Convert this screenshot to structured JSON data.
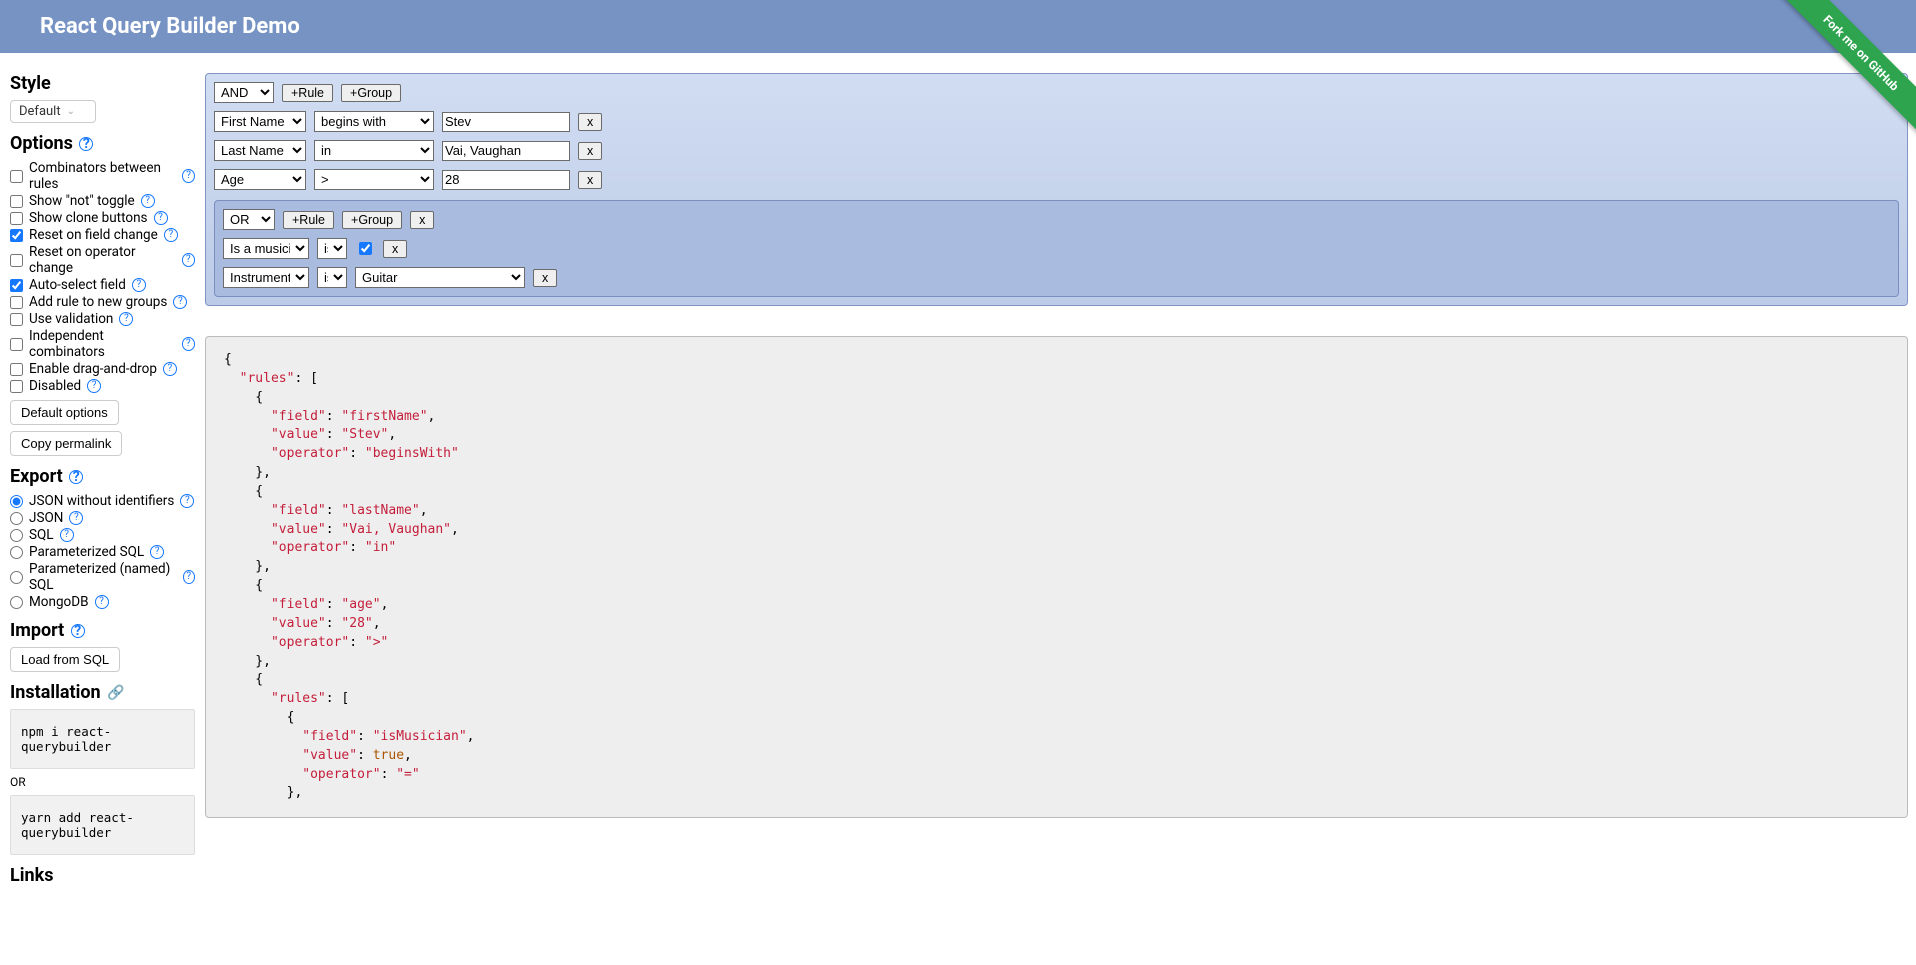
{
  "app": {
    "title": "React Query Builder Demo",
    "fork_label": "Fork me on GitHub"
  },
  "sidebar": {
    "style_heading": "Style",
    "style_value": "Default",
    "options_heading": "Options",
    "options": [
      {
        "label": "Combinators between rules",
        "checked": false
      },
      {
        "label": "Show \"not\" toggle",
        "checked": false
      },
      {
        "label": "Show clone buttons",
        "checked": false
      },
      {
        "label": "Reset on field change",
        "checked": true
      },
      {
        "label": "Reset on operator change",
        "checked": false
      },
      {
        "label": "Auto-select field",
        "checked": true
      },
      {
        "label": "Add rule to new groups",
        "checked": false
      },
      {
        "label": "Use validation",
        "checked": false
      },
      {
        "label": "Independent combinators",
        "checked": false
      },
      {
        "label": "Enable drag-and-drop",
        "checked": false
      },
      {
        "label": "Disabled",
        "checked": false
      }
    ],
    "default_options_btn": "Default options",
    "copy_permalink_btn": "Copy permalink",
    "export_heading": "Export",
    "export_options": [
      {
        "label": "JSON without identifiers",
        "checked": true
      },
      {
        "label": "JSON",
        "checked": false
      },
      {
        "label": "SQL",
        "checked": false
      },
      {
        "label": "Parameterized SQL",
        "checked": false
      },
      {
        "label": "Parameterized (named) SQL",
        "checked": false
      },
      {
        "label": "MongoDB",
        "checked": false
      }
    ],
    "import_heading": "Import",
    "load_sql_btn": "Load from SQL",
    "install_heading": "Installation",
    "install_npm": "npm i react-querybuilder",
    "install_or": "OR",
    "install_yarn": "yarn add react-querybuilder",
    "links_heading": "Links"
  },
  "qb": {
    "combinator": "AND",
    "add_rule": "+Rule",
    "add_group": "+Group",
    "remove": "x",
    "rules": [
      {
        "field": "First Name",
        "op": "begins with",
        "value": "Stev"
      },
      {
        "field": "Last Name",
        "op": "in",
        "value": "Vai, Vaughan"
      },
      {
        "field": "Age",
        "op": ">",
        "value": "28"
      }
    ],
    "inner": {
      "combinator": "OR",
      "rules": [
        {
          "field": "Is a musician",
          "op": "is",
          "checked": true
        },
        {
          "field": "Instrument",
          "op": "is",
          "value": "Guitar"
        }
      ]
    }
  },
  "export_text": "{\n  \"rules\": [\n    {\n      \"field\": \"firstName\",\n      \"value\": \"Stev\",\n      \"operator\": \"beginsWith\"\n    },\n    {\n      \"field\": \"lastName\",\n      \"value\": \"Vai, Vaughan\",\n      \"operator\": \"in\"\n    },\n    {\n      \"field\": \"age\",\n      \"value\": \"28\",\n      \"operator\": \">\"\n    },\n    {\n      \"rules\": [\n        {\n          \"field\": \"isMusician\",\n          \"value\": true,\n          \"operator\": \"=\"\n        },"
}
